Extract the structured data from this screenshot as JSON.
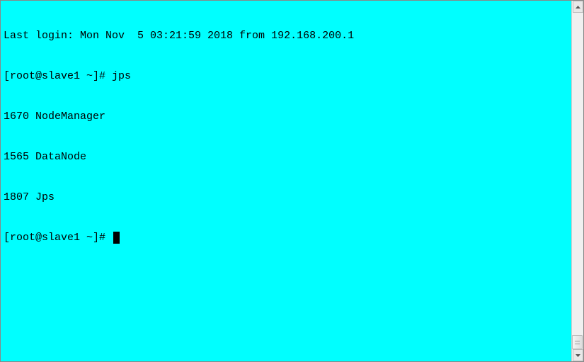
{
  "terminal": {
    "last_login": "Last login: Mon Nov  5 03:21:59 2018 from 192.168.200.1",
    "prompt1": "[root@slave1 ~]# ",
    "command1": "jps",
    "output": [
      "1670 NodeManager",
      "1565 DataNode",
      "1807 Jps"
    ],
    "prompt2": "[root@slave1 ~]# "
  }
}
